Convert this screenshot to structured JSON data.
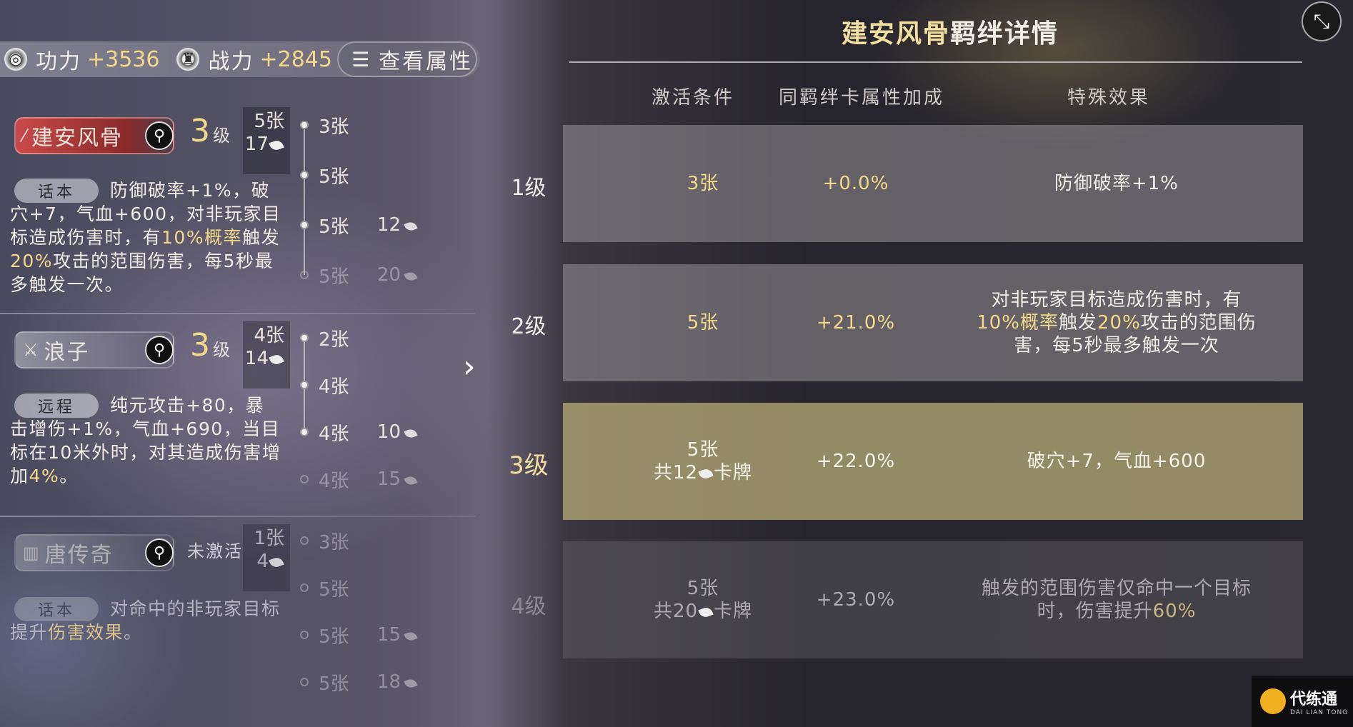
{
  "topbar": {
    "power_label": "功力",
    "power_value": "+3536",
    "combat_label": "战力",
    "combat_value": "+2845",
    "view_attrs": "查看属性"
  },
  "bonds": [
    {
      "name": "建安风骨",
      "state": "active",
      "level_num": "3",
      "level_unit": "级",
      "count_line1": "5张",
      "count_line2": "17",
      "tag": "话本",
      "desc_parts": [
        "防御破率+1%，破穴+7，气血+600，对非玩家目标造成伤害时，有",
        "10%概率",
        "触发",
        "20%",
        "攻击的范围伤害，每5秒最多触发一次。"
      ],
      "tiers": [
        {
          "label": "3张",
          "cards": "",
          "on": true
        },
        {
          "label": "5张",
          "cards": "",
          "on": true
        },
        {
          "label": "5张",
          "cards": "12",
          "on": true
        },
        {
          "label": "5张",
          "cards": "20",
          "on": false
        }
      ]
    },
    {
      "name": "浪子",
      "state": "normal",
      "level_num": "3",
      "level_unit": "级",
      "count_line1": "4张",
      "count_line2": "14",
      "tag": "远程",
      "desc_parts": [
        "纯元攻击+80，暴击增伤+1%，气血+690，当目标在10米外时，对其造成伤害增加",
        "4%",
        "。"
      ],
      "tiers": [
        {
          "label": "2张",
          "cards": "",
          "on": true
        },
        {
          "label": "4张",
          "cards": "",
          "on": true
        },
        {
          "label": "4张",
          "cards": "10",
          "on": true
        },
        {
          "label": "4张",
          "cards": "15",
          "on": false
        }
      ]
    },
    {
      "name": "唐传奇",
      "state": "inactive",
      "inactive_label": "未激活",
      "count_line1": "1张",
      "count_line2": "4",
      "tag": "话本",
      "desc_parts": [
        "对命中的非玩家目标提升",
        "伤害效果",
        "。"
      ],
      "tiers": [
        {
          "label": "3张",
          "cards": "",
          "on": false
        },
        {
          "label": "5张",
          "cards": "",
          "on": false
        },
        {
          "label": "5张",
          "cards": "15",
          "on": false
        },
        {
          "label": "5张",
          "cards": "18",
          "on": false
        }
      ]
    }
  ],
  "panel": {
    "title_highlight": "建安风骨",
    "title_rest": "羁绊详情",
    "columns": [
      "激活条件",
      "同羁绊卡属性加成",
      "特殊效果"
    ],
    "rows": [
      {
        "level": "1级",
        "state": "normal",
        "cond_line1": "3张",
        "cond_line2": "",
        "bonus": "+0.0%",
        "effect_parts": [
          "防御破率+1%"
        ]
      },
      {
        "level": "2级",
        "state": "normal",
        "cond_line1": "5张",
        "cond_line2": "",
        "bonus": "+21.0%",
        "effect_parts": [
          "对非玩家目标造成伤害时，有",
          "10%概率",
          "触发",
          "20%",
          "攻击的范围伤害，每5秒最多触发一次"
        ]
      },
      {
        "level": "3级",
        "state": "active",
        "cond_line1": "5张",
        "cond_line2_pre": "共12",
        "cond_line2_post": "卡牌",
        "bonus": "+22.0%",
        "effect_parts": [
          "破穴+7，气血+600"
        ]
      },
      {
        "level": "4级",
        "state": "locked",
        "cond_line1": "5张",
        "cond_line2_pre": "共20",
        "cond_line2_post": "卡牌",
        "bonus": "+23.0%",
        "effect_parts": [
          "触发的范围伤害仅命中一个目标时，伤害提升",
          "60%"
        ]
      }
    ]
  },
  "watermark": {
    "name": "代练通",
    "sub": "DAI LIAN TONG"
  },
  "colors": {
    "gold": "#f3d98a",
    "active_bond": "#c94a4a",
    "active_row": "#b2a876"
  }
}
